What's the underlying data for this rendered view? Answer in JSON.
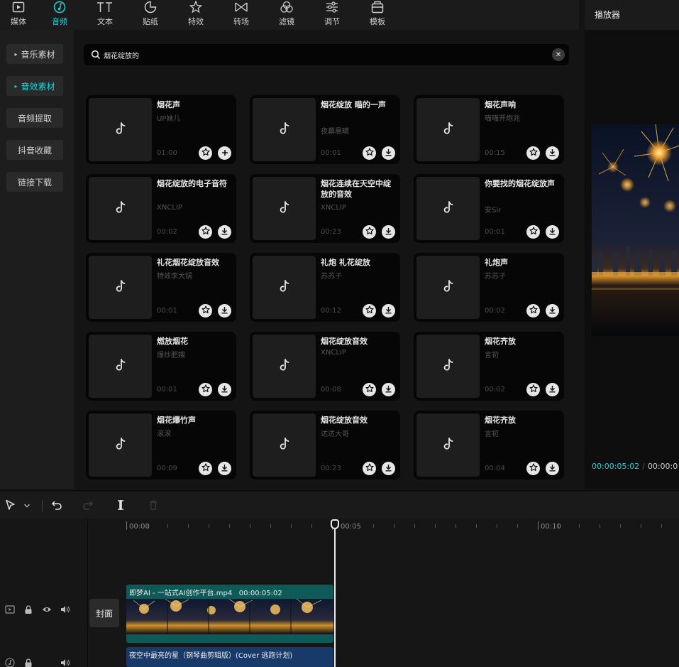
{
  "toolbar": {
    "items": [
      {
        "label": "媒体",
        "icon": "media-icon"
      },
      {
        "label": "音频",
        "icon": "audio-icon",
        "active": true
      },
      {
        "label": "文本",
        "icon": "text-icon"
      },
      {
        "label": "贴纸",
        "icon": "sticker-icon"
      },
      {
        "label": "特效",
        "icon": "effects-icon"
      },
      {
        "label": "转场",
        "icon": "transition-icon"
      },
      {
        "label": "滤镜",
        "icon": "filter-icon"
      },
      {
        "label": "调节",
        "icon": "adjust-icon"
      },
      {
        "label": "模板",
        "icon": "template-icon"
      }
    ]
  },
  "player": {
    "title": "播放器",
    "current_time": "00:00:05:02",
    "total_time": "00:00:0"
  },
  "sidebar": {
    "items": [
      {
        "label": "音乐素材",
        "active": false,
        "triangle": "▸"
      },
      {
        "label": "音效素材",
        "active": true,
        "triangle": "▸"
      },
      {
        "label": "音频提取"
      },
      {
        "label": "抖音收藏"
      },
      {
        "label": "链接下载"
      }
    ]
  },
  "search": {
    "value": "烟花绽放的",
    "clear_glyph": "✕"
  },
  "sounds": [
    {
      "title": "烟花声",
      "author": "UP妹儿",
      "duration": "01:00",
      "action": "add"
    },
    {
      "title": "烟花绽放 瞄的一声",
      "author": "夜幕晨曦",
      "duration": "00:01",
      "action": "download"
    },
    {
      "title": "烟花声响",
      "author": "喵喵开炮兆",
      "duration": "00:15",
      "action": "download"
    },
    {
      "title": "烟花绽放的电子音符",
      "author": "XNCLIP",
      "duration": "00:02",
      "action": "download"
    },
    {
      "title": "烟花连续在天空中绽放的音效",
      "author": "XNCLIP",
      "duration": "00:23",
      "action": "download"
    },
    {
      "title": "你要找的烟花绽放声",
      "author": "安Sir",
      "duration": "00:01",
      "action": "download"
    },
    {
      "title": "礼花烟花绽放音效",
      "author": "特效李大锅",
      "duration": "00:01",
      "action": "download"
    },
    {
      "title": "礼炮 礼花绽放",
      "author": "苏苏子",
      "duration": "00:12",
      "action": "download"
    },
    {
      "title": "礼炮声",
      "author": "苏苏子",
      "duration": "00:02",
      "action": "download"
    },
    {
      "title": "燃放烟花",
      "author": "爆炒肥嫂",
      "duration": "00:01",
      "action": "download"
    },
    {
      "title": "烟花绽放音效",
      "author": "XNCLIP",
      "duration": "00:08",
      "action": "download"
    },
    {
      "title": "烟花齐放",
      "author": "言初",
      "duration": "00:02",
      "action": "download"
    },
    {
      "title": "烟花爆竹声",
      "author": "滚滚",
      "duration": "00:09",
      "action": "download"
    },
    {
      "title": "烟花绽放音效",
      "author": "达达大哥",
      "duration": "00:23",
      "action": "download"
    },
    {
      "title": "烟花齐放",
      "author": "言初",
      "duration": "00:04",
      "action": "download"
    }
  ],
  "timeline": {
    "ruler": [
      "00:00",
      "00:05",
      "00:10"
    ],
    "cover_label": "封面",
    "video_clip": {
      "name": "即梦AI - 一站式AI创作平台.mp4",
      "duration": "00:00:05:02"
    },
    "audio_clip": {
      "name": "夜空中最亮的星（钢琴曲剪辑版）(Cover 逃跑计划)"
    }
  },
  "colors": {
    "accent": "#1fd3d8",
    "video_clip": "#0e5a58",
    "audio_clip": "#183a6a"
  }
}
